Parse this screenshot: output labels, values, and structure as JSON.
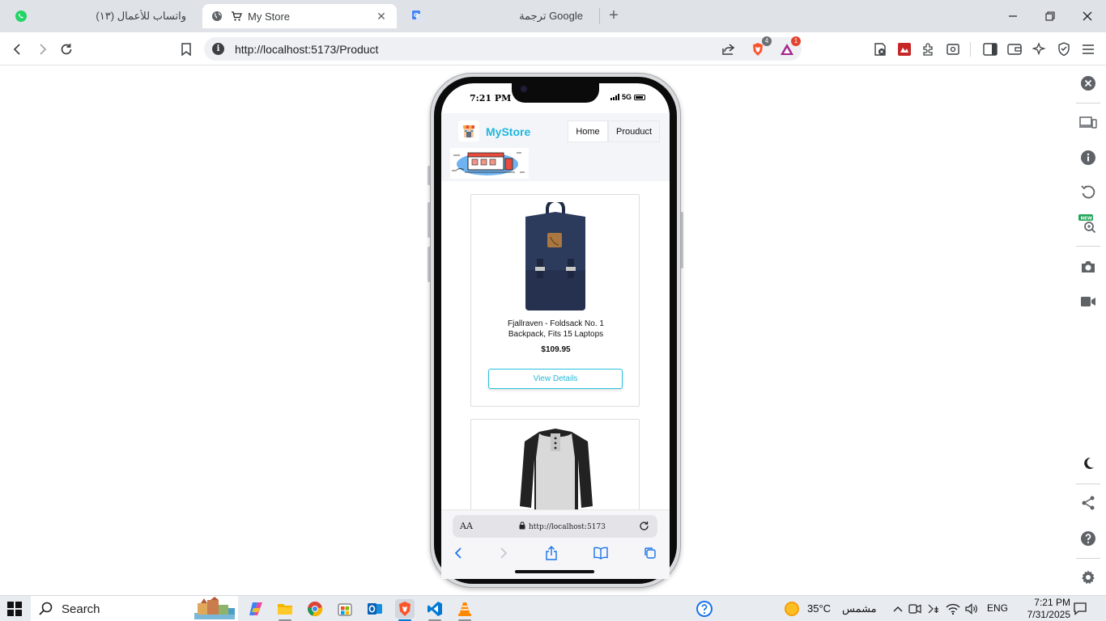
{
  "browser": {
    "tabs": [
      {
        "title": "(١٣) واتساب للأعمال",
        "active": false
      },
      {
        "title": "My Store",
        "active": true
      },
      {
        "title": "ترجمة Google",
        "active": false
      }
    ],
    "url": "http://localhost:5173/Product",
    "badges": {
      "brave_shield": "4",
      "brave_rewards": "1"
    }
  },
  "phone": {
    "status_time": "7:21 PM",
    "network": "5G",
    "app": {
      "brand": "MyStore",
      "nav": [
        "Home",
        "Prouduct"
      ]
    },
    "products": [
      {
        "title": "Fjallraven - Foldsack No. 1 Backpack, Fits 15 Laptops",
        "price": "$109.95",
        "button": "View Details"
      }
    ],
    "safari": {
      "text_size_label": "AA",
      "address": "http://localhost:5173"
    }
  },
  "taskbar": {
    "search_label": "Search",
    "weather": {
      "temp": "35°C",
      "condition": "مشمس"
    },
    "language": "ENG",
    "time": "7:21 PM",
    "date": "7/31/2025"
  },
  "colors": {
    "brand": "#1fb7df",
    "accent": "#27c1e0",
    "taskbar_accent": "#0078d4"
  }
}
